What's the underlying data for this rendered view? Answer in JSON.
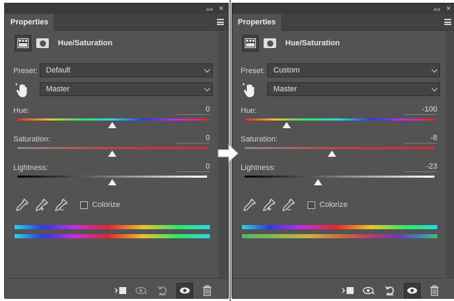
{
  "window_controls": {
    "collapse": "««",
    "close": "✕"
  },
  "panels": [
    {
      "tab_label": "Properties",
      "adjustment_title": "Hue/Saturation",
      "preset_label": "Preset:",
      "preset_value": "Default",
      "channel_value": "Master",
      "hue_label": "Hue:",
      "hue_value": "0",
      "hue": 0,
      "saturation_label": "Saturation:",
      "saturation_value": "0",
      "saturation": 0,
      "lightness_label": "Lightness:",
      "lightness_value": "0",
      "lightness": 0,
      "colorize_label": "Colorize"
    },
    {
      "tab_label": "Properties",
      "adjustment_title": "Hue/Saturation",
      "preset_label": "Preset:",
      "preset_value": "Custom",
      "channel_value": "Master",
      "hue_label": "Hue:",
      "hue_value": "-100",
      "hue": -100,
      "saturation_label": "Saturation:",
      "saturation_value": "-8",
      "saturation": -8,
      "lightness_label": "Lightness:",
      "lightness_value": "-23",
      "lightness": -23,
      "colorize_label": "Colorize"
    }
  ],
  "ranges": {
    "hue": [
      -180,
      180
    ],
    "saturation": [
      -100,
      100
    ],
    "lightness": [
      -100,
      100
    ]
  },
  "colors": {
    "panel_bg": "#535353",
    "hue_spectrum": [
      "#e8262a",
      "#e8c52a",
      "#2ae86a",
      "#2ad6e8",
      "#2a3ae8",
      "#c82ae8",
      "#e8262a"
    ],
    "arrow": "#ffffff"
  },
  "icons": {
    "adjustment": "levels-grid-icon",
    "mask": "layer-mask-icon",
    "targeted_adjust": "hand-scrubby-icon",
    "eyedropper": "eyedropper-icon",
    "eyedropper_add": "eyedropper-plus-icon",
    "eyedropper_subtract": "eyedropper-minus-icon",
    "clip": "clip-to-layer-icon",
    "view_previous": "view-previous-state-icon",
    "reset": "reset-icon",
    "visibility": "eye-icon",
    "delete": "trash-icon",
    "transition": "right-arrow-icon"
  }
}
